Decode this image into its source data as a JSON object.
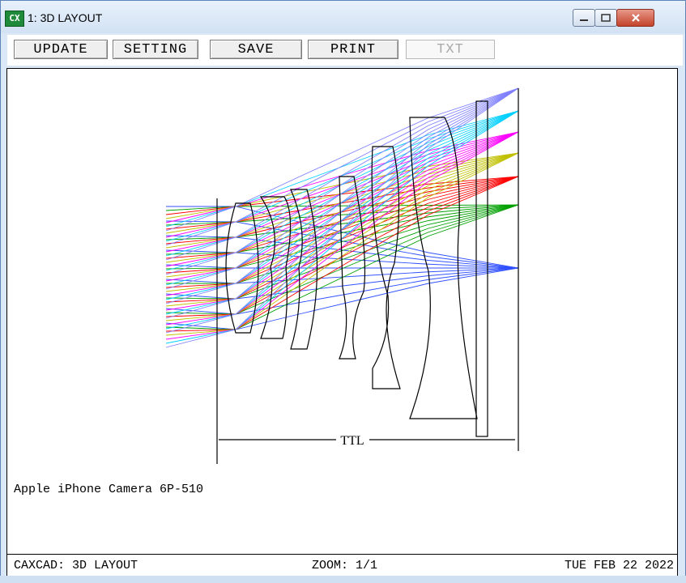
{
  "window": {
    "icon_text": "CX",
    "title": "1: 3D LAYOUT",
    "buttons": {
      "minimize": "minimize-icon",
      "maximize": "maximize-icon",
      "close": "close-icon"
    }
  },
  "toolbar": {
    "buttons": [
      {
        "label": "UPDATE",
        "enabled": true
      },
      {
        "label": "SETTING",
        "enabled": true
      },
      {
        "label": "SAVE",
        "enabled": true
      },
      {
        "label": "PRINT",
        "enabled": true
      },
      {
        "label": "TXT",
        "enabled": false
      }
    ]
  },
  "layout": {
    "dimension_label": "TTL",
    "ray_colors": [
      "#3050ff",
      "#00a000",
      "#ff0000",
      "#c0c000",
      "#ff00ff",
      "#00d0ff",
      "#8080ff"
    ]
  },
  "caption": {
    "text": "Apple iPhone Camera 6P-510"
  },
  "status": {
    "left": "CAXCAD: 3D LAYOUT",
    "zoom": "ZOOM: 1/1",
    "date": "TUE FEB 22 2022"
  }
}
